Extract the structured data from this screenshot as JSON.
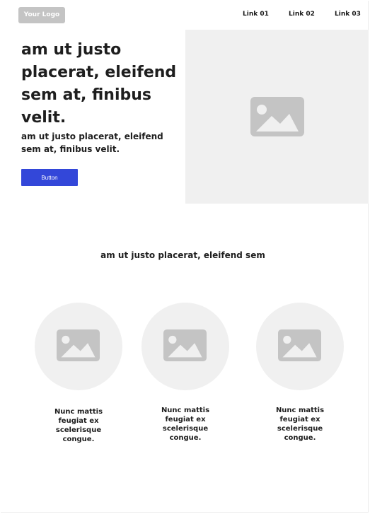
{
  "header": {
    "logo": "Your Logo",
    "nav": [
      "Link 01",
      "Link 02",
      "Link 03"
    ]
  },
  "hero": {
    "title": "am ut justo placerat, eleifend sem at, finibus velit.",
    "subtitle": "am ut justo placerat, eleifend sem at, finibus velit.",
    "button": "Button",
    "image_icon": "image-placeholder-icon"
  },
  "section": {
    "title": "am ut justo placerat, eleifend sem"
  },
  "features": [
    {
      "caption": "Nunc mattis feugiat ex scelerisque congue.",
      "icon": "image-placeholder-icon"
    },
    {
      "caption": "Nunc mattis feugiat ex scelerisque congue.",
      "icon": "image-placeholder-icon"
    },
    {
      "caption": "Nunc mattis feugiat ex scelerisque congue.",
      "icon": "image-placeholder-icon"
    }
  ],
  "colors": {
    "accent": "#3347d9",
    "placeholder_bg": "#f0f0f0",
    "placeholder_icon": "#c4c4c4",
    "logo_bg": "#c4c4c4"
  }
}
